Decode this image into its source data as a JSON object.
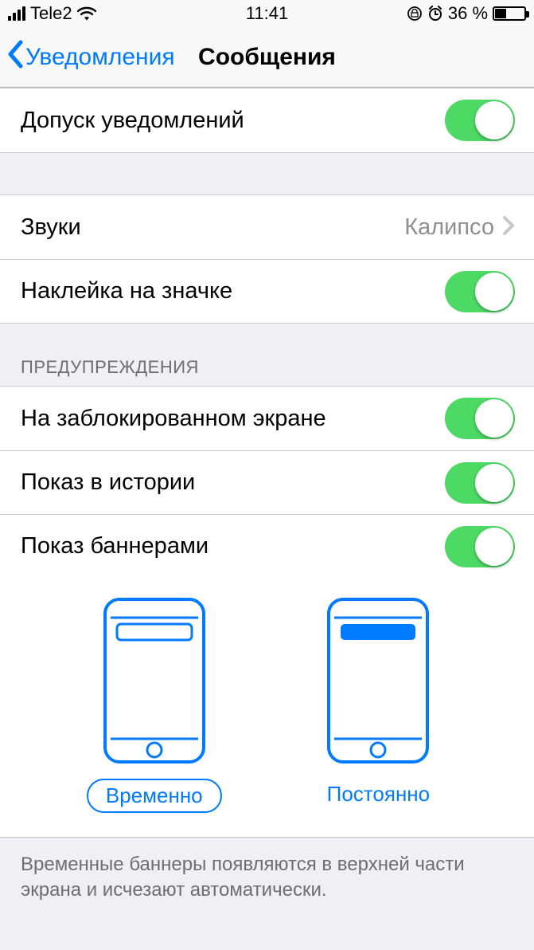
{
  "status_bar": {
    "carrier": "Tele2",
    "time": "11:41",
    "battery_percent": "36 %"
  },
  "nav": {
    "back_label": "Уведомления",
    "title": "Сообщения"
  },
  "rows": {
    "allow": {
      "label": "Допуск уведомлений",
      "on": true
    },
    "sounds": {
      "label": "Звуки",
      "value": "Калипсо"
    },
    "badge": {
      "label": "Наклейка на значке",
      "on": true
    },
    "alerts_header": "ПРЕДУПРЕЖДЕНИЯ",
    "lock_screen": {
      "label": "На заблокированном экране",
      "on": true
    },
    "history": {
      "label": "Показ в истории",
      "on": true
    },
    "banners": {
      "label": "Показ баннерами",
      "on": true
    }
  },
  "banner_style": {
    "temporary": "Временно",
    "persistent": "Постоянно",
    "selected": "temporary"
  },
  "footer": "Временные баннеры появляются в верхней части экрана и исчезают автоматически."
}
